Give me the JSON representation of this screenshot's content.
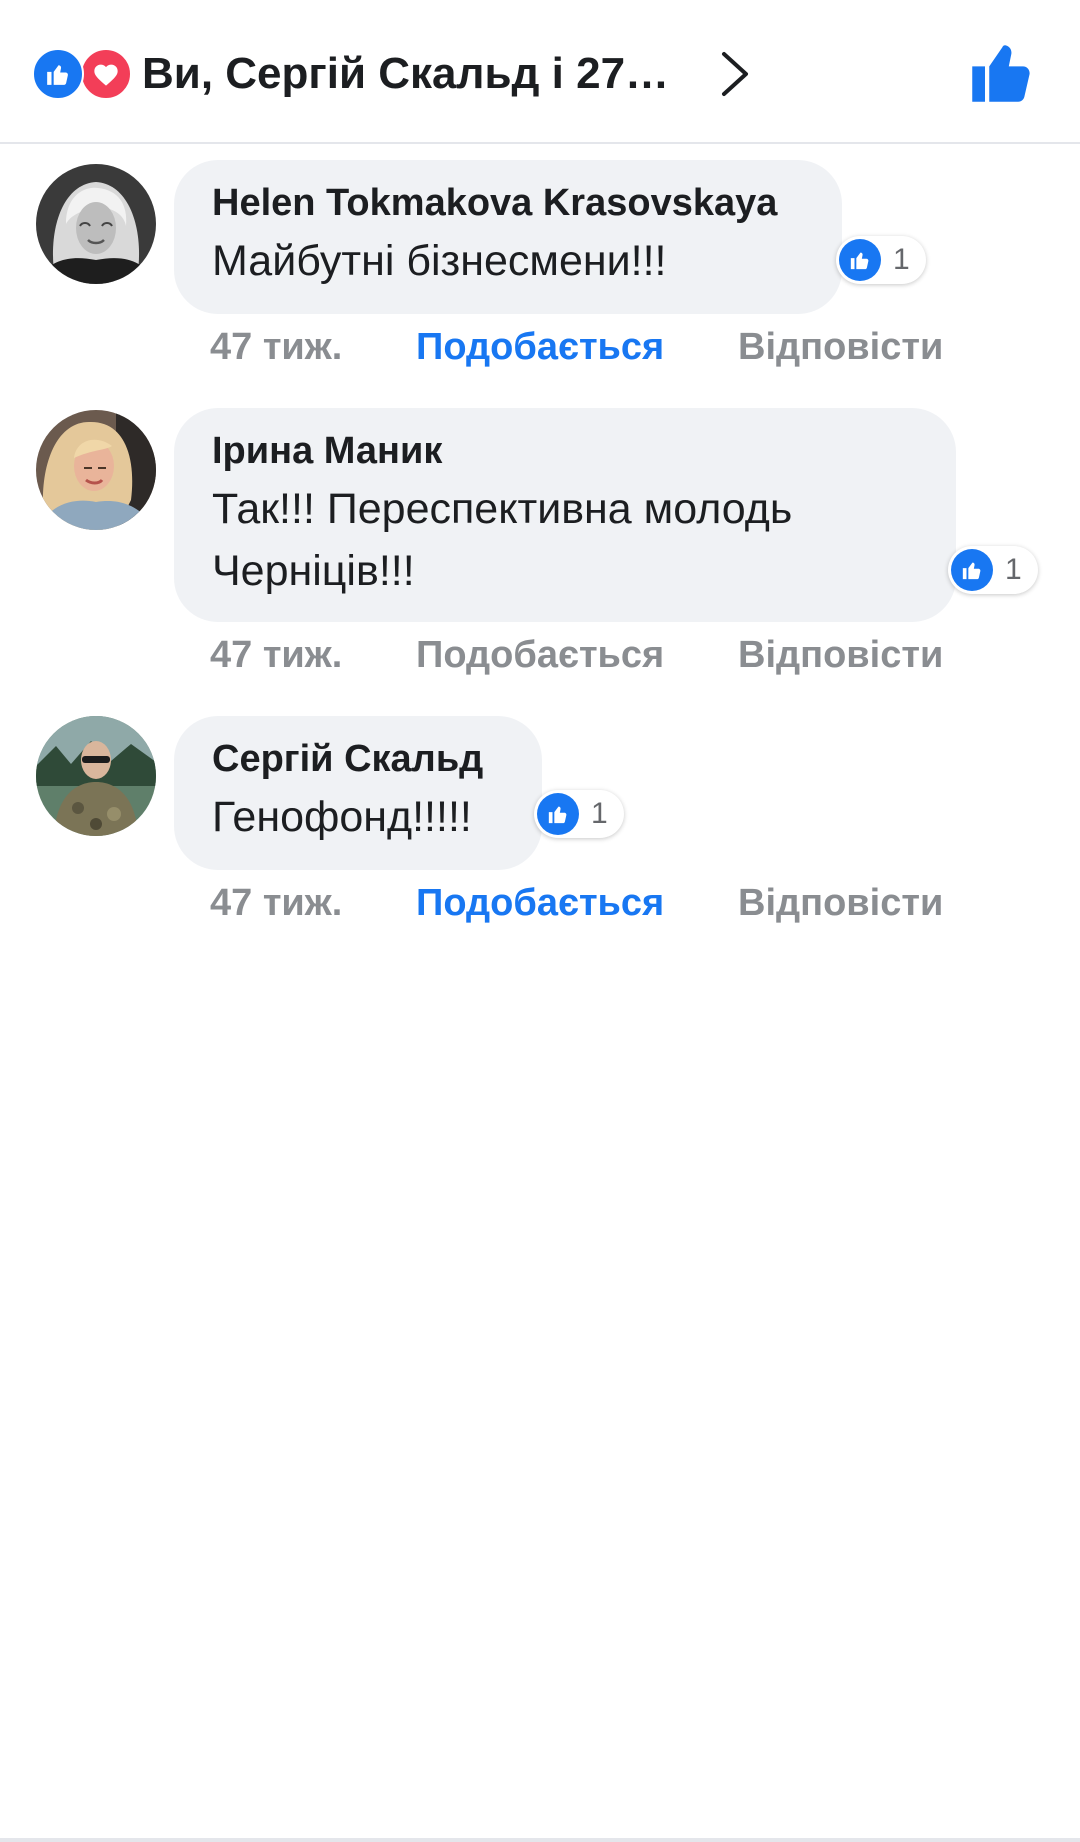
{
  "header": {
    "title": "Ви, Сергій Скальд і 27…",
    "reaction_icons": [
      "like-icon",
      "love-icon"
    ],
    "accent_color": "#1877f2",
    "love_color": "#f33e58"
  },
  "comments": [
    {
      "author": "Helen Tokmakova Krasovskaya",
      "text": "Майбутні бізнесмени!!!",
      "likes": "1",
      "time": "47 тиж.",
      "like_label": "Подобається",
      "like_active": true,
      "reply_label": "Відповісти"
    },
    {
      "author": "Ірина Маник",
      "text": "Так!!! Переспективна молодь Черніців!!!",
      "likes": "1",
      "time": "47 тиж.",
      "like_label": "Подобається",
      "like_active": false,
      "reply_label": "Відповісти"
    },
    {
      "author": "Сергій Скальд",
      "text": "Генофонд!!!!!",
      "likes": "1",
      "time": "47 тиж.",
      "like_label": "Подобається",
      "like_active": true,
      "reply_label": "Відповісти"
    }
  ]
}
